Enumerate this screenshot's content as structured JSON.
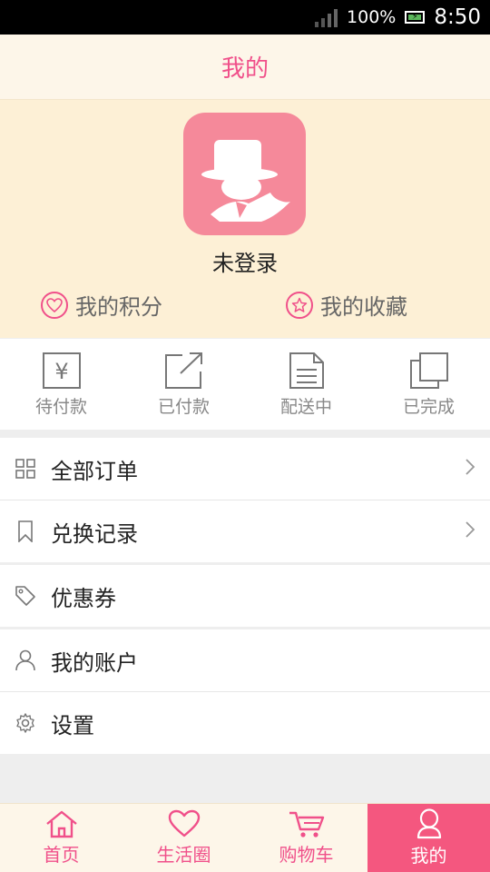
{
  "statusbar": {
    "battery": "100%",
    "time": "8:50"
  },
  "header": {
    "title": "我的"
  },
  "profile": {
    "login_status": "未登录",
    "points_label": "我的积分",
    "favorites_label": "我的收藏"
  },
  "orders": {
    "pending_payment": "待付款",
    "paid": "已付款",
    "shipping": "配送中",
    "completed": "已完成",
    "yen_glyph": "¥"
  },
  "menu": {
    "all_orders": "全部订单",
    "exchange_records": "兑换记录",
    "coupons": "优惠券",
    "my_account": "我的账户",
    "settings": "设置"
  },
  "tabbar": {
    "home": "首页",
    "life_circle": "生活圈",
    "cart": "购物车",
    "mine": "我的"
  },
  "colors": {
    "accent": "#f0508a",
    "header_bg": "#fdf6e9",
    "profile_bg": "#fdf0d6",
    "avatar_bg": "#f5899a",
    "tab_active_bg": "#f4577f"
  }
}
